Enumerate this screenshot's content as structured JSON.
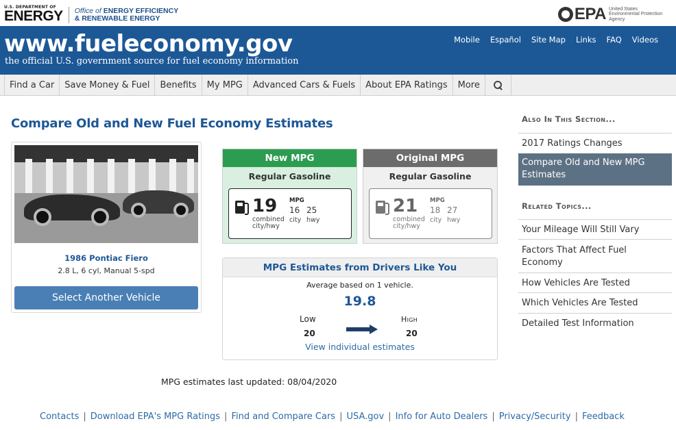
{
  "agency": {
    "doe_small": "U.S. DEPARTMENT OF",
    "doe_big": "ENERGY",
    "eere_line1_prefix": "Office of",
    "eere_line1_rest": "ENERGY EFFICIENCY",
    "eere_line2": "& RENEWABLE ENERGY",
    "epa_logo": "EPA",
    "epa_text_1": "United States",
    "epa_text_2": "Environmental Protection",
    "epa_text_3": "Agency"
  },
  "banner": {
    "title": "www.fueleconomy.gov",
    "tagline": "the official U.S. government source for fuel economy information",
    "links": [
      "Mobile",
      "Español",
      "Site Map",
      "Links",
      "FAQ",
      "Videos"
    ]
  },
  "nav": {
    "items": [
      "Find a Car",
      "Save Money & Fuel",
      "Benefits",
      "My MPG",
      "Advanced Cars & Fuels",
      "About EPA Ratings",
      "More"
    ],
    "search_icon": "magnifier-icon"
  },
  "page": {
    "title": "Compare Old and New Fuel Economy Estimates"
  },
  "vehicle": {
    "name": "1986 Pontiac Fiero",
    "desc": "2.8 L, 6 cyl, Manual 5-spd",
    "select_label": "Select Another Vehicle"
  },
  "new_mpg": {
    "header": "New MPG",
    "fuel": "Regular Gasoline",
    "combined": "19",
    "combined_label_1": "combined",
    "combined_label_2": "city/hwy",
    "mpg_word": "MPG",
    "city": "16",
    "hwy": "25",
    "city_label": "city",
    "hwy_label": "hwy",
    "color": "#2c9c51"
  },
  "orig_mpg": {
    "header": "Original MPG",
    "fuel": "Regular Gasoline",
    "combined": "21",
    "combined_label_1": "combined",
    "combined_label_2": "city/hwy",
    "mpg_word": "MPG",
    "city": "18",
    "hwy": "27",
    "city_label": "city",
    "hwy_label": "hwy",
    "color": "#6c6c6c"
  },
  "drivers": {
    "header": "MPG Estimates from Drivers Like You",
    "average_text": "Average based on 1 vehicle.",
    "average_value": "19.8",
    "low_label": "Low",
    "high_label": "High",
    "low_value": "20",
    "high_value": "20",
    "view_link": "View individual estimates"
  },
  "updated": "MPG estimates last updated: 08/04/2020",
  "sidebar": {
    "section_heading": "Also In This Section...",
    "section_items": [
      "2017 Ratings Changes",
      "Compare Old and New MPG Estimates"
    ],
    "related_heading": "Related Topics...",
    "related_items": [
      "Your Mileage Will Still Vary",
      "Factors That Affect Fuel Economy",
      "How Vehicles Are Tested",
      "Which Vehicles Are Tested",
      "Detailed Test Information"
    ]
  },
  "footer": {
    "links": [
      "Contacts",
      "Download EPA's MPG Ratings",
      "Find and Compare Cars",
      "USA.gov",
      "Info for Auto Dealers",
      "Privacy/Security",
      "Feedback"
    ],
    "separator": "|"
  },
  "colors": {
    "brand_blue": "#1d5896",
    "link_blue": "#2e6aa8",
    "button_blue": "#4a7fb5",
    "sidebar_active": "#5d7184"
  }
}
